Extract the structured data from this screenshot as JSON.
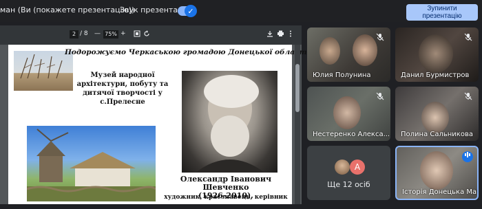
{
  "top_bar": {
    "presenting_text": "ман (Ви (покажете презентацію))",
    "sound_label": "Звук презентації",
    "sound_toggle": "on",
    "stop_button_line1": "Зупинити",
    "stop_button_line2": "презентацію"
  },
  "pdf_viewer": {
    "current_page": "2",
    "page_separator": "/ 8",
    "zoom": "75%",
    "zoom_minus": "—",
    "zoom_plus": "+",
    "page": {
      "title": "Подорожуємо Черкаською громадою Донецької області",
      "museum_text": "Музей народної архітектури, побуту та дитячої творчості у с.Прелесне",
      "caption_line1": "Олександр Іванович Шевченко",
      "caption_line2": "(1926-2010),",
      "caption_line3": "художник, краєзнавець, керівник"
    }
  },
  "participants": [
    {
      "name": "Юлия Полунина",
      "muted": true
    },
    {
      "name": "Данил Бурмистров",
      "muted": true
    },
    {
      "name": "Нестеренко Алекса...",
      "muted": true
    },
    {
      "name": "Полина Сальникова",
      "muted": true
    },
    {
      "name": "Ще 12 осіб",
      "avatar_letter": "A"
    },
    {
      "name": "Історія Донецька Ман",
      "speaking": true
    }
  ],
  "icons": {
    "mic_off": "mic-off-icon",
    "download": "download-icon",
    "print": "print-icon",
    "more": "more-vert-icon",
    "fit": "fit-page-icon",
    "rotate": "rotate-icon"
  },
  "colors": {
    "toggle_accent": "#8ab4f8",
    "stop_button": "#a8c7fa",
    "active_speaker_border": "#8ab4f8"
  }
}
